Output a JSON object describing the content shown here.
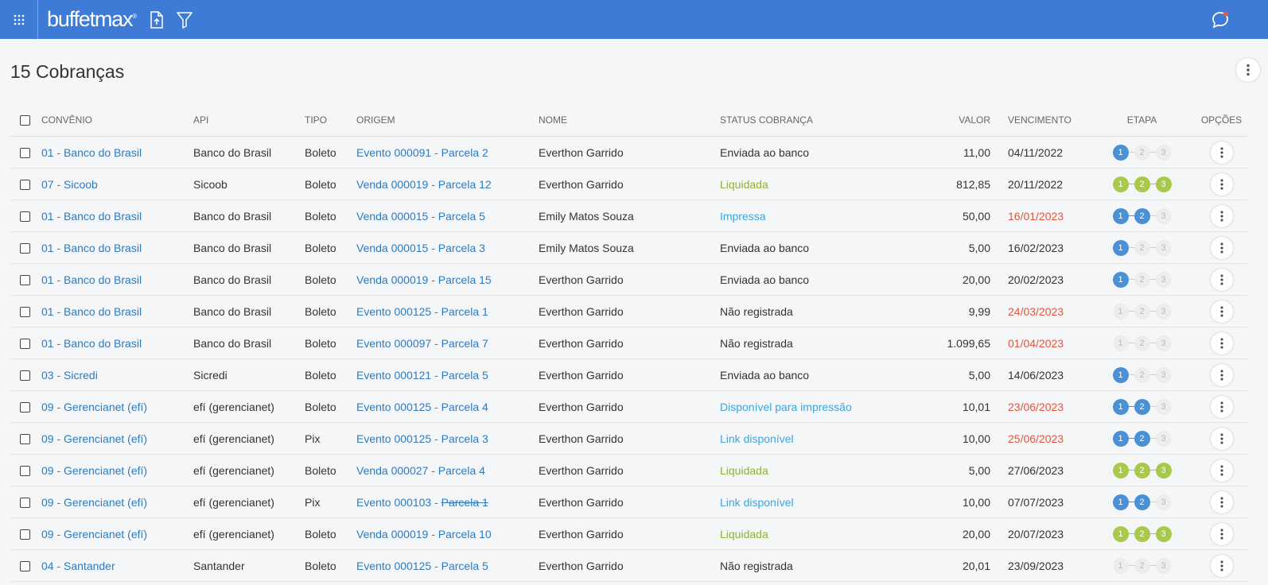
{
  "app": {
    "logo": "buffetmax",
    "logo_mark": "®",
    "icons": [
      "apps-grid-icon",
      "export-icon",
      "filter-icon",
      "chat-icon"
    ],
    "brand_color": "#3e7bd6"
  },
  "page": {
    "title": "15 Cobranças"
  },
  "table": {
    "headers": {
      "convenio": "CONVÊNIO",
      "api": "API",
      "tipo": "TIPO",
      "origem": "ORIGEM",
      "nome": "NOME",
      "status": "STATUS COBRANÇA",
      "valor": "VALOR",
      "vencimento": "VENCIMENTO",
      "etapa": "ETAPA",
      "opcoes": "OPÇÕES"
    },
    "rows": [
      {
        "convenio": "01 - Banco do Brasil",
        "api": "Banco do Brasil",
        "tipo": "Boleto",
        "origem_a": "Evento 000091 - Parcela 2",
        "origem_b": "",
        "nome": "Everthon Garrido",
        "status": "Enviada ao banco",
        "status_color": "dark",
        "valor": "11,00",
        "vencimento": "04/11/2022",
        "overdue": false,
        "etapa": 1,
        "etapa_color": "blue"
      },
      {
        "convenio": "07 - Sicoob",
        "api": "Sicoob",
        "tipo": "Boleto",
        "origem_a": "Venda 000019 - Parcela 12",
        "origem_b": "",
        "nome": "Everthon Garrido",
        "status": "Liquidada",
        "status_color": "green",
        "valor": "812,85",
        "vencimento": "20/11/2022",
        "overdue": false,
        "etapa": 3,
        "etapa_color": "green"
      },
      {
        "convenio": "01 - Banco do Brasil",
        "api": "Banco do Brasil",
        "tipo": "Boleto",
        "origem_a": "Venda 000015 - Parcela 5",
        "origem_b": "",
        "nome": "Emily Matos Souza",
        "status": "Impressa",
        "status_color": "blue",
        "valor": "50,00",
        "vencimento": "16/01/2023",
        "overdue": true,
        "etapa": 2,
        "etapa_color": "blue"
      },
      {
        "convenio": "01 - Banco do Brasil",
        "api": "Banco do Brasil",
        "tipo": "Boleto",
        "origem_a": "Venda 000015 - Parcela 3",
        "origem_b": "",
        "nome": "Emily Matos Souza",
        "status": "Enviada ao banco",
        "status_color": "dark",
        "valor": "5,00",
        "vencimento": "16/02/2023",
        "overdue": false,
        "etapa": 1,
        "etapa_color": "blue"
      },
      {
        "convenio": "01 - Banco do Brasil",
        "api": "Banco do Brasil",
        "tipo": "Boleto",
        "origem_a": "Venda 000019 - Parcela 15",
        "origem_b": "",
        "nome": "Everthon Garrido",
        "status": "Enviada ao banco",
        "status_color": "dark",
        "valor": "20,00",
        "vencimento": "20/02/2023",
        "overdue": false,
        "etapa": 1,
        "etapa_color": "blue"
      },
      {
        "convenio": "01 - Banco do Brasil",
        "api": "Banco do Brasil",
        "tipo": "Boleto",
        "origem_a": "Evento 000125 - Parcela 1",
        "origem_b": "",
        "nome": "Everthon Garrido",
        "status": "Não registrada",
        "status_color": "dark",
        "valor": "9,99",
        "vencimento": "24/03/2023",
        "overdue": true,
        "etapa": 0,
        "etapa_color": "grey"
      },
      {
        "convenio": "01 - Banco do Brasil",
        "api": "Banco do Brasil",
        "tipo": "Boleto",
        "origem_a": "Evento 000097 - Parcela 7",
        "origem_b": "",
        "nome": "Everthon Garrido",
        "status": "Não registrada",
        "status_color": "dark",
        "valor": "1.099,65",
        "vencimento": "01/04/2023",
        "overdue": true,
        "etapa": 0,
        "etapa_color": "grey"
      },
      {
        "convenio": "03 - Sicredi",
        "api": "Sicredi",
        "tipo": "Boleto",
        "origem_a": "Evento 000121 - Parcela 5",
        "origem_b": "",
        "nome": "Everthon Garrido",
        "status": "Enviada ao banco",
        "status_color": "dark",
        "valor": "5,00",
        "vencimento": "14/06/2023",
        "overdue": false,
        "etapa": 1,
        "etapa_color": "blue"
      },
      {
        "convenio": "09 - Gerencianet (efí)",
        "api": "efí (gerencianet)",
        "tipo": "Boleto",
        "origem_a": "Evento 000125 - Parcela 4",
        "origem_b": "",
        "nome": "Everthon Garrido",
        "status": "Disponível para impressão",
        "status_color": "blue",
        "valor": "10,01",
        "vencimento": "23/06/2023",
        "overdue": true,
        "etapa": 2,
        "etapa_color": "blue"
      },
      {
        "convenio": "09 - Gerencianet (efí)",
        "api": "efí (gerencianet)",
        "tipo": "Pix",
        "origem_a": "Evento 000125 - Parcela 3",
        "origem_b": "",
        "nome": "Everthon Garrido",
        "status": "Link disponível",
        "status_color": "blue",
        "valor": "10,00",
        "vencimento": "25/06/2023",
        "overdue": true,
        "etapa": 2,
        "etapa_color": "blue"
      },
      {
        "convenio": "09 - Gerencianet (efí)",
        "api": "efí (gerencianet)",
        "tipo": "Boleto",
        "origem_a": "Venda 000027 - Parcela 4",
        "origem_b": "",
        "nome": "Everthon Garrido",
        "status": "Liquidada",
        "status_color": "green",
        "valor": "5,00",
        "vencimento": "27/06/2023",
        "overdue": false,
        "etapa": 3,
        "etapa_color": "green"
      },
      {
        "convenio": "09 - Gerencianet (efí)",
        "api": "efí (gerencianet)",
        "tipo": "Pix",
        "origem_a": "Evento 000103 - ",
        "origem_b": "Parcela 1",
        "nome": "Everthon Garrido",
        "status": "Link disponível",
        "status_color": "blue",
        "valor": "10,00",
        "vencimento": "07/07/2023",
        "overdue": false,
        "etapa": 2,
        "etapa_color": "blue"
      },
      {
        "convenio": "09 - Gerencianet (efí)",
        "api": "efí (gerencianet)",
        "tipo": "Boleto",
        "origem_a": "Venda 000019 - Parcela 10",
        "origem_b": "",
        "nome": "Everthon Garrido",
        "status": "Liquidada",
        "status_color": "green",
        "valor": "20,00",
        "vencimento": "20/07/2023",
        "overdue": false,
        "etapa": 3,
        "etapa_color": "green"
      },
      {
        "convenio": "04 - Santander",
        "api": "Santander",
        "tipo": "Boleto",
        "origem_a": "Evento 000125 - Parcela 5",
        "origem_b": "",
        "nome": "Everthon Garrido",
        "status": "Não registrada",
        "status_color": "dark",
        "valor": "20,01",
        "vencimento": "23/09/2023",
        "overdue": false,
        "etapa": 0,
        "etapa_color": "grey"
      }
    ]
  }
}
